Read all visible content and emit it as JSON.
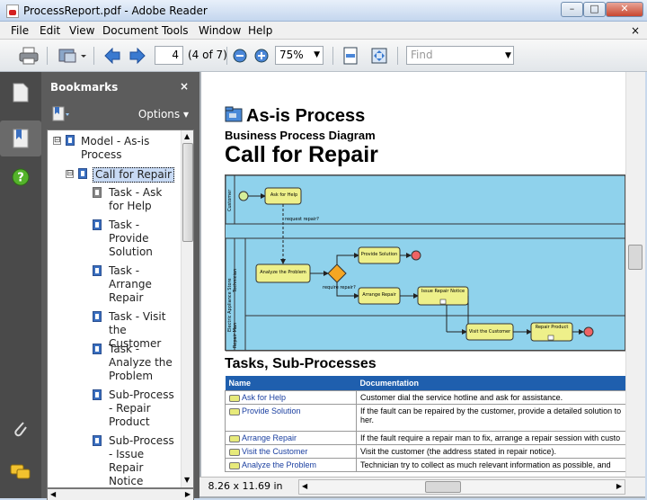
{
  "window": {
    "title": "ProcessReport.pdf - Adobe Reader",
    "min": "–",
    "max": "□",
    "close": "✕"
  },
  "menu": [
    "File",
    "Edit",
    "View",
    "Document",
    "Tools",
    "Window",
    "Help"
  ],
  "menu_close": "×",
  "toolbar": {
    "page": "4",
    "page_of": "(4 of 7)",
    "zoom": "75%",
    "find_placeholder": "Find"
  },
  "bookmarks": {
    "title": "Bookmarks",
    "close": "×",
    "options": "Options ▾",
    "items": [
      {
        "label": "Model - As-is Process",
        "pm": "⊟"
      },
      {
        "label": "Call for Repair",
        "pm": "⊟"
      },
      {
        "label": "Task - Ask for Help"
      },
      {
        "label": "Task - Provide Solution"
      },
      {
        "label": "Task - Arrange Repair"
      },
      {
        "label": "Task - Visit the Customer"
      },
      {
        "label": "Task - Analyze the Problem"
      },
      {
        "label": "Sub-Process - Repair Product"
      },
      {
        "label": "Sub-Process - Issue Repair Notice"
      }
    ]
  },
  "document": {
    "heading": "As-is Process",
    "subheading": "Business Process Diagram",
    "title": "Call for Repair",
    "diagram": {
      "pool_top": "Customer",
      "pool_mid_outer": "Electric Appliance Store",
      "pool_mid_inner": "Technician",
      "pool_bottom": "Repair Man",
      "tasks": {
        "ask": "Ask for Help",
        "analyze": "Analyze the Problem",
        "provide": "Provide Solution",
        "arrange": "Arrange Repair",
        "notice": "Issue Repair Notice",
        "visit": "Visit the Customer",
        "repair": "Repair Product"
      },
      "flows": {
        "request": "request repair?",
        "require": "require repair?"
      }
    },
    "section": "Tasks, Sub-Processes",
    "table": {
      "headers": [
        "Name",
        "Documentation"
      ],
      "rows": [
        {
          "name": "Ask for Help",
          "doc": "Customer dial the service hotline and ask for assistance."
        },
        {
          "name": "Provide Solution",
          "doc": "If the fault can be repaired by the customer, provide a detailed solution to",
          "doc2": "her."
        },
        {
          "name": "Arrange Repair",
          "doc": "If the fault require a repair man to fix, arrange a repair session with custo"
        },
        {
          "name": "Visit the Customer",
          "doc": "Visit the customer (the address stated in repair notice)."
        },
        {
          "name": "Analyze the Problem",
          "doc": "Technician try to collect as much relevant information as possible, and"
        }
      ]
    }
  },
  "status": {
    "page_size": "8.26 x 11.69 in"
  }
}
